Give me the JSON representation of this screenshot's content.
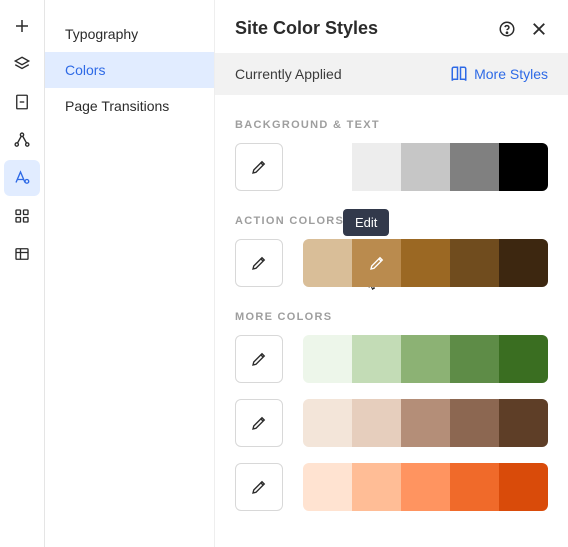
{
  "rail": {
    "items": [
      {
        "name": "add-icon"
      },
      {
        "name": "layers-icon"
      },
      {
        "name": "page-icon"
      },
      {
        "name": "connections-icon"
      },
      {
        "name": "styles-icon",
        "active": true
      },
      {
        "name": "apps-grid-icon"
      },
      {
        "name": "table-icon"
      }
    ]
  },
  "sidenav": {
    "items": [
      {
        "label": "Typography",
        "name": "sidenav-typography"
      },
      {
        "label": "Colors",
        "name": "sidenav-colors",
        "active": true
      },
      {
        "label": "Page Transitions",
        "name": "sidenav-page-transitions"
      }
    ]
  },
  "panel": {
    "title": "Site Color Styles",
    "applied_label": "Currently Applied",
    "more_styles_label": "More Styles",
    "tooltip_edit": "Edit",
    "groups": [
      {
        "label": "BACKGROUND & TEXT",
        "name": "group-background-text",
        "rows": [
          {
            "colors": [
              "#ffffff",
              "#ededed",
              "#c6c6c6",
              "#808080",
              "#000000"
            ]
          }
        ]
      },
      {
        "label": "ACTION COLORS",
        "name": "group-action-colors",
        "rows": [
          {
            "colors": [
              "#d9be98",
              "#ba8b4e",
              "#9b6823",
              "#704c1e",
              "#3d2710"
            ],
            "hovered_index": 1,
            "show_tooltip": true
          }
        ]
      },
      {
        "label": "MORE COLORS",
        "name": "group-more-colors",
        "rows": [
          {
            "colors": [
              "#edf6ea",
              "#c3dcb6",
              "#8cb274",
              "#5e8c47",
              "#3a6e21"
            ]
          },
          {
            "colors": [
              "#f3e5d9",
              "#e6cebd",
              "#b48e78",
              "#8c6751",
              "#5e3e27"
            ]
          },
          {
            "colors": [
              "#ffe3d1",
              "#ffbd96",
              "#ff9460",
              "#f06a2a",
              "#d94b0a"
            ]
          }
        ]
      }
    ]
  }
}
